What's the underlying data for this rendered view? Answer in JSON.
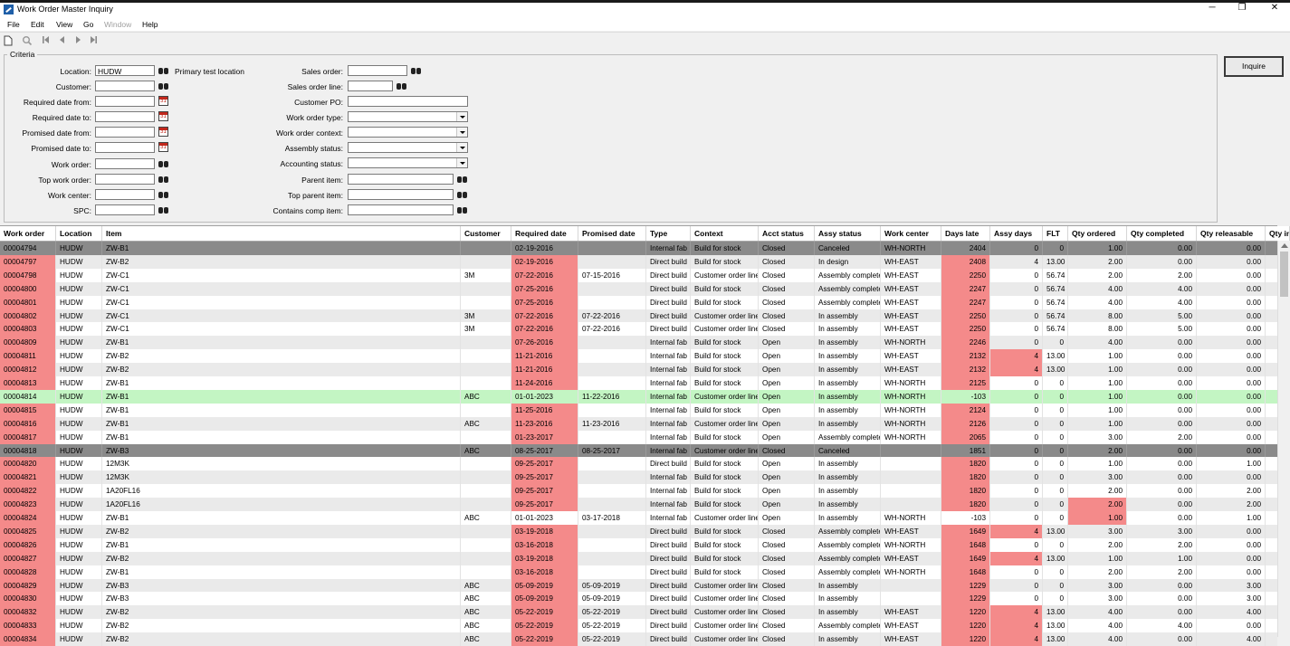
{
  "window": {
    "title": "Work Order Master Inquiry",
    "minimize": "─",
    "restore": "❐",
    "close": "✕"
  },
  "menu": [
    "File",
    "Edit",
    "View",
    "Go",
    "Window",
    "Help"
  ],
  "criteria": {
    "group_label": "Criteria",
    "location": {
      "label": "Location:",
      "value": "HUDW",
      "note": "Primary test location"
    },
    "customer": {
      "label": "Customer:"
    },
    "required_from": {
      "label": "Required date from:"
    },
    "required_to": {
      "label": "Required date to:"
    },
    "promised_from": {
      "label": "Promised date from:"
    },
    "promised_to": {
      "label": "Promised date to:"
    },
    "work_order": {
      "label": "Work order:"
    },
    "top_work_order": {
      "label": "Top work order:"
    },
    "work_center": {
      "label": "Work center:"
    },
    "spc": {
      "label": "SPC:"
    },
    "sales_order": {
      "label": "Sales order:"
    },
    "sales_order_line": {
      "label": "Sales order line:"
    },
    "customer_po": {
      "label": "Customer PO:"
    },
    "work_order_type": {
      "label": "Work order type:"
    },
    "work_order_context": {
      "label": "Work order context:"
    },
    "assembly_status": {
      "label": "Assembly status:"
    },
    "accounting_status": {
      "label": "Accounting status:"
    },
    "parent_item": {
      "label": "Parent item:"
    },
    "top_parent_item": {
      "label": "Top parent item:"
    },
    "contains_comp_item": {
      "label": "Contains comp item:"
    },
    "calendar_day": "31"
  },
  "inquire_label": "Inquire",
  "colors": {
    "late": "#f48a8a",
    "green": "#c3f5c3",
    "canceled": "#8a8a8a",
    "stripe": "#eaeaea"
  },
  "grid": {
    "columns": [
      "Work order",
      "Location",
      "Item",
      "Customer",
      "Required date",
      "Promised date",
      "Type",
      "Context",
      "Acct status",
      "Assy status",
      "Work center",
      "Days late",
      "Assy days",
      "FLT",
      "Qty ordered",
      "Qty completed",
      "Qty releasable",
      "Qty in"
    ],
    "rows": [
      {
        "status": "canceled",
        "cells": [
          "00004794",
          "HUDW",
          "ZW-B1",
          "",
          "02-19-2016",
          "",
          "Internal fab",
          "Build for stock",
          "Closed",
          "Canceled",
          "WH-NORTH",
          "2404",
          "0",
          "0",
          "1.00",
          "0.00",
          "0.00"
        ]
      },
      {
        "status": "late",
        "cells": [
          "00004797",
          "HUDW",
          "ZW-B2",
          "",
          "02-19-2016",
          "",
          "Direct build",
          "Build for stock",
          "Closed",
          "In design",
          "WH-EAST",
          "2408",
          "4",
          "13.00",
          "2.00",
          "0.00",
          "0.00"
        ]
      },
      {
        "status": "late",
        "cells": [
          "00004798",
          "HUDW",
          "ZW-C1",
          "3M",
          "07-22-2016",
          "07-15-2016",
          "Direct build",
          "Customer order line",
          "Closed",
          "Assembly complete",
          "WH-EAST",
          "2250",
          "0",
          "56.74",
          "2.00",
          "2.00",
          "0.00"
        ]
      },
      {
        "status": "late",
        "cells": [
          "00004800",
          "HUDW",
          "ZW-C1",
          "",
          "07-25-2016",
          "",
          "Direct build",
          "Build for stock",
          "Closed",
          "Assembly complete",
          "WH-EAST",
          "2247",
          "0",
          "56.74",
          "4.00",
          "4.00",
          "0.00"
        ]
      },
      {
        "status": "late",
        "cells": [
          "00004801",
          "HUDW",
          "ZW-C1",
          "",
          "07-25-2016",
          "",
          "Direct build",
          "Build for stock",
          "Closed",
          "Assembly complete",
          "WH-EAST",
          "2247",
          "0",
          "56.74",
          "4.00",
          "4.00",
          "0.00"
        ]
      },
      {
        "status": "late",
        "cells": [
          "00004802",
          "HUDW",
          "ZW-C1",
          "3M",
          "07-22-2016",
          "07-22-2016",
          "Direct build",
          "Customer order line",
          "Closed",
          "In assembly",
          "WH-EAST",
          "2250",
          "0",
          "56.74",
          "8.00",
          "5.00",
          "0.00"
        ]
      },
      {
        "status": "late",
        "cells": [
          "00004803",
          "HUDW",
          "ZW-C1",
          "3M",
          "07-22-2016",
          "07-22-2016",
          "Direct build",
          "Customer order line",
          "Closed",
          "In assembly",
          "WH-EAST",
          "2250",
          "0",
          "56.74",
          "8.00",
          "5.00",
          "0.00"
        ]
      },
      {
        "status": "late",
        "cells": [
          "00004809",
          "HUDW",
          "ZW-B1",
          "",
          "07-26-2016",
          "",
          "Internal fab",
          "Build for stock",
          "Open",
          "In assembly",
          "WH-NORTH",
          "2246",
          "0",
          "0",
          "4.00",
          "0.00",
          "0.00"
        ]
      },
      {
        "status": "late",
        "assyHi": true,
        "cells": [
          "00004811",
          "HUDW",
          "ZW-B2",
          "",
          "11-21-2016",
          "",
          "Internal fab",
          "Build for stock",
          "Open",
          "In assembly",
          "WH-EAST",
          "2132",
          "4",
          "13.00",
          "1.00",
          "0.00",
          "0.00"
        ]
      },
      {
        "status": "late",
        "assyHi": true,
        "cells": [
          "00004812",
          "HUDW",
          "ZW-B2",
          "",
          "11-21-2016",
          "",
          "Internal fab",
          "Build for stock",
          "Open",
          "In assembly",
          "WH-EAST",
          "2132",
          "4",
          "13.00",
          "1.00",
          "0.00",
          "0.00"
        ]
      },
      {
        "status": "late",
        "cells": [
          "00004813",
          "HUDW",
          "ZW-B1",
          "",
          "11-24-2016",
          "",
          "Internal fab",
          "Build for stock",
          "Open",
          "In assembly",
          "WH-NORTH",
          "2125",
          "0",
          "0",
          "1.00",
          "0.00",
          "0.00"
        ]
      },
      {
        "status": "green",
        "cells": [
          "00004814",
          "HUDW",
          "ZW-B1",
          "ABC",
          "01-01-2023",
          "11-22-2016",
          "Internal fab",
          "Customer order line",
          "Open",
          "In assembly",
          "WH-NORTH",
          "-103",
          "0",
          "0",
          "1.00",
          "0.00",
          "0.00"
        ]
      },
      {
        "status": "late",
        "cells": [
          "00004815",
          "HUDW",
          "ZW-B1",
          "",
          "11-25-2016",
          "",
          "Internal fab",
          "Build for stock",
          "Open",
          "In assembly",
          "WH-NORTH",
          "2124",
          "0",
          "0",
          "1.00",
          "0.00",
          "0.00"
        ]
      },
      {
        "status": "late",
        "cells": [
          "00004816",
          "HUDW",
          "ZW-B1",
          "ABC",
          "11-23-2016",
          "11-23-2016",
          "Internal fab",
          "Customer order line",
          "Open",
          "In assembly",
          "WH-NORTH",
          "2126",
          "0",
          "0",
          "1.00",
          "0.00",
          "0.00"
        ]
      },
      {
        "status": "late",
        "cells": [
          "00004817",
          "HUDW",
          "ZW-B1",
          "",
          "01-23-2017",
          "",
          "Internal fab",
          "Build for stock",
          "Open",
          "Assembly complete",
          "WH-NORTH",
          "2065",
          "0",
          "0",
          "3.00",
          "2.00",
          "0.00"
        ]
      },
      {
        "status": "canceled",
        "cells": [
          "00004818",
          "HUDW",
          "ZW-B3",
          "ABC",
          "08-25-2017",
          "08-25-2017",
          "Internal fab",
          "Customer order line",
          "Closed",
          "Canceled",
          "",
          "1851",
          "0",
          "0",
          "2.00",
          "0.00",
          "0.00"
        ]
      },
      {
        "status": "late",
        "cells": [
          "00004820",
          "HUDW",
          "12M3K",
          "",
          "09-25-2017",
          "",
          "Direct build",
          "Build for stock",
          "Open",
          "In assembly",
          "",
          "1820",
          "0",
          "0",
          "1.00",
          "0.00",
          "1.00"
        ]
      },
      {
        "status": "late",
        "cells": [
          "00004821",
          "HUDW",
          "12M3K",
          "",
          "09-25-2017",
          "",
          "Internal fab",
          "Build for stock",
          "Open",
          "In assembly",
          "",
          "1820",
          "0",
          "0",
          "3.00",
          "0.00",
          "0.00"
        ]
      },
      {
        "status": "late",
        "cells": [
          "00004822",
          "HUDW",
          "1A20FL16",
          "",
          "09-25-2017",
          "",
          "Internal fab",
          "Build for stock",
          "Open",
          "In assembly",
          "",
          "1820",
          "0",
          "0",
          "2.00",
          "0.00",
          "2.00"
        ]
      },
      {
        "status": "late",
        "qtyHi": true,
        "cells": [
          "00004823",
          "HUDW",
          "1A20FL16",
          "",
          "09-25-2017",
          "",
          "Internal fab",
          "Build for stock",
          "Open",
          "In assembly",
          "",
          "1820",
          "0",
          "0",
          "2.00",
          "0.00",
          "2.00"
        ]
      },
      {
        "status": "plain",
        "qtyHi": true,
        "cells": [
          "00004824",
          "HUDW",
          "ZW-B1",
          "ABC",
          "01-01-2023",
          "03-17-2018",
          "Internal fab",
          "Customer order line",
          "Open",
          "In assembly",
          "WH-NORTH",
          "-103",
          "0",
          "0",
          "1.00",
          "0.00",
          "1.00"
        ]
      },
      {
        "status": "late",
        "assyHi": true,
        "cells": [
          "00004825",
          "HUDW",
          "ZW-B2",
          "",
          "03-19-2018",
          "",
          "Direct build",
          "Build for stock",
          "Closed",
          "Assembly complete",
          "WH-EAST",
          "1649",
          "4",
          "13.00",
          "3.00",
          "3.00",
          "0.00"
        ]
      },
      {
        "status": "late",
        "cells": [
          "00004826",
          "HUDW",
          "ZW-B1",
          "",
          "03-16-2018",
          "",
          "Direct build",
          "Build for stock",
          "Closed",
          "Assembly complete",
          "WH-NORTH",
          "1648",
          "0",
          "0",
          "2.00",
          "2.00",
          "0.00"
        ]
      },
      {
        "status": "late",
        "assyHi": true,
        "cells": [
          "00004827",
          "HUDW",
          "ZW-B2",
          "",
          "03-19-2018",
          "",
          "Direct build",
          "Build for stock",
          "Closed",
          "Assembly complete",
          "WH-EAST",
          "1649",
          "4",
          "13.00",
          "1.00",
          "1.00",
          "0.00"
        ]
      },
      {
        "status": "late",
        "cells": [
          "00004828",
          "HUDW",
          "ZW-B1",
          "",
          "03-16-2018",
          "",
          "Direct build",
          "Build for stock",
          "Closed",
          "Assembly complete",
          "WH-NORTH",
          "1648",
          "0",
          "0",
          "2.00",
          "2.00",
          "0.00"
        ]
      },
      {
        "status": "late",
        "cells": [
          "00004829",
          "HUDW",
          "ZW-B3",
          "ABC",
          "05-09-2019",
          "05-09-2019",
          "Direct build",
          "Customer order line",
          "Closed",
          "In assembly",
          "",
          "1229",
          "0",
          "0",
          "3.00",
          "0.00",
          "3.00"
        ]
      },
      {
        "status": "late",
        "cells": [
          "00004830",
          "HUDW",
          "ZW-B3",
          "ABC",
          "05-09-2019",
          "05-09-2019",
          "Direct build",
          "Customer order line",
          "Closed",
          "In assembly",
          "",
          "1229",
          "0",
          "0",
          "3.00",
          "0.00",
          "3.00"
        ]
      },
      {
        "status": "late",
        "assyHi": true,
        "cells": [
          "00004832",
          "HUDW",
          "ZW-B2",
          "ABC",
          "05-22-2019",
          "05-22-2019",
          "Direct build",
          "Customer order line",
          "Closed",
          "In assembly",
          "WH-EAST",
          "1220",
          "4",
          "13.00",
          "4.00",
          "0.00",
          "4.00"
        ]
      },
      {
        "status": "late",
        "assyHi": true,
        "cells": [
          "00004833",
          "HUDW",
          "ZW-B2",
          "ABC",
          "05-22-2019",
          "05-22-2019",
          "Direct build",
          "Customer order line",
          "Closed",
          "Assembly complete",
          "WH-EAST",
          "1220",
          "4",
          "13.00",
          "4.00",
          "4.00",
          "0.00"
        ]
      },
      {
        "status": "late",
        "assyHi": true,
        "cells": [
          "00004834",
          "HUDW",
          "ZW-B2",
          "ABC",
          "05-22-2019",
          "05-22-2019",
          "Direct build",
          "Customer order line",
          "Closed",
          "In assembly",
          "WH-EAST",
          "1220",
          "4",
          "13.00",
          "4.00",
          "0.00",
          "4.00"
        ]
      }
    ]
  }
}
